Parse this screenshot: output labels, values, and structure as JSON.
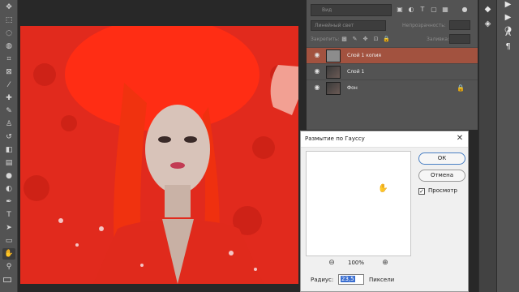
{
  "toolbar": {
    "tools": [
      "move-tool",
      "marquee-tool",
      "lasso-tool",
      "quick-select-tool",
      "crop-tool",
      "frame-tool",
      "eyedropper-tool",
      "healing-tool",
      "brush-tool",
      "stamp-tool",
      "history-brush-tool",
      "eraser-tool",
      "gradient-tool",
      "blur-tool",
      "dodge-tool",
      "pen-tool",
      "type-tool",
      "path-select-tool",
      "rectangle-tool",
      "hand-tool",
      "zoom-tool"
    ],
    "active_tool": "hand-tool"
  },
  "layers_panel": {
    "search_placeholder": "Вид",
    "blend_mode": "Линейный свет",
    "opacity_label": "Непрозрачность:",
    "lock_label": "Закрепить:",
    "fill_label": "Заливка:",
    "layers": [
      {
        "name": "Слой 1 копия",
        "selected": true,
        "visible": true,
        "locked": false,
        "thumb": "gray"
      },
      {
        "name": "Слой 1",
        "selected": false,
        "visible": true,
        "locked": false,
        "thumb": "photo"
      },
      {
        "name": "Фон",
        "selected": false,
        "visible": true,
        "locked": true,
        "thumb": "photo"
      }
    ]
  },
  "dialog": {
    "title": "Размытие по Гауссу",
    "close_glyph": "✕",
    "ok_label": "ОК",
    "cancel_label": "Отмена",
    "preview_label": "Просмотр",
    "preview_checked": true,
    "check_glyph": "✓",
    "zoom_out_glyph": "⊖",
    "zoom_in_glyph": "⊕",
    "zoom_level": "100%",
    "radius_label": "Радиус:",
    "radius_value": "23,5",
    "radius_unit": "Пиксели"
  },
  "colors": {
    "accent_selected_layer": "#a2523f",
    "photo_red": "#e0281c",
    "panel_bg": "#535353",
    "app_bg": "#282828"
  }
}
